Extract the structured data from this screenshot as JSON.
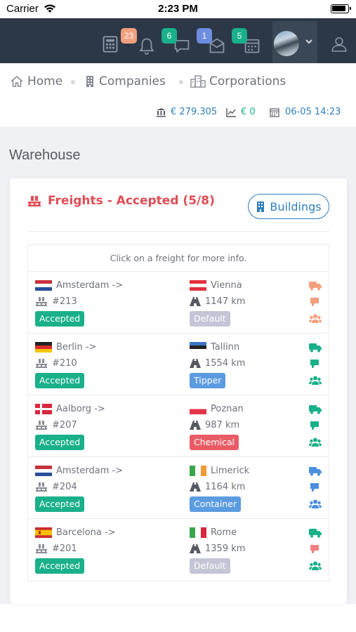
{
  "status_bar": {
    "carrier": "Carrier",
    "time": "2:23 PM"
  },
  "topbar": {
    "badges": [
      {
        "count": "23",
        "icon": "bell-icon",
        "color": "#f4a07e"
      },
      {
        "count": "6",
        "icon": "chat-icon",
        "color": "#19b08a"
      },
      {
        "count": "1",
        "icon": "mail-icon",
        "color": "#6d8de0"
      },
      {
        "count": "5",
        "icon": "calendar-icon",
        "color": "#19b08a"
      }
    ]
  },
  "breadcrumb": {
    "home": "Home",
    "companies": "Companies",
    "corporations": "Corporations"
  },
  "stats": {
    "balance": "€ 279.305",
    "profit": "€ 0",
    "datetime": "06-05 14:23"
  },
  "page": {
    "title": "Warehouse"
  },
  "card": {
    "title": "Freights - Accepted (5/8)",
    "buildings_button": "Buildings",
    "hint": "Click on a freight for more info."
  },
  "freights": [
    {
      "from": "Amsterdam ->",
      "id": "#213",
      "status": "Accepted",
      "to": "Vienna",
      "distance": "1147 km",
      "type": "Default",
      "type_color": "#c4c5d6",
      "icon_color": "#f4a07e",
      "from_flag": "nl",
      "to_flag": "at"
    },
    {
      "from": "Berlin ->",
      "id": "#210",
      "status": "Accepted",
      "to": "Tallinn",
      "distance": "1554 km",
      "type": "Tipper",
      "type_color": "#5b9be0",
      "icon_color": "#19b08a",
      "from_flag": "de",
      "to_flag": "ee"
    },
    {
      "from": "Aalborg ->",
      "id": "#207",
      "status": "Accepted",
      "to": "Poznan",
      "distance": "987 km",
      "type": "Chemical",
      "type_color": "#e95c66",
      "icon_color": "#19b08a",
      "from_flag": "dk",
      "to_flag": "pl"
    },
    {
      "from": "Amsterdam ->",
      "id": "#204",
      "status": "Accepted",
      "to": "Limerick",
      "distance": "1164 km",
      "type": "Container",
      "type_color": "#5b9be0",
      "icon_color": "#4a8fe0",
      "from_flag": "nl",
      "to_flag": "ie"
    },
    {
      "from": "Barcelona ->",
      "id": "#201",
      "status": "Accepted",
      "to": "Rome",
      "distance": "1359 km",
      "type": "Default",
      "type_color": "#c4c5d6",
      "icon_color_truck": "#19b08a",
      "icon_color": "#f08080",
      "from_flag": "es",
      "to_flag": "it"
    }
  ],
  "colors": {
    "accent_red": "#e14c54",
    "accent_blue": "#2e7fc0",
    "accepted_green": "#19b08a",
    "topbar": "#2c3847"
  }
}
